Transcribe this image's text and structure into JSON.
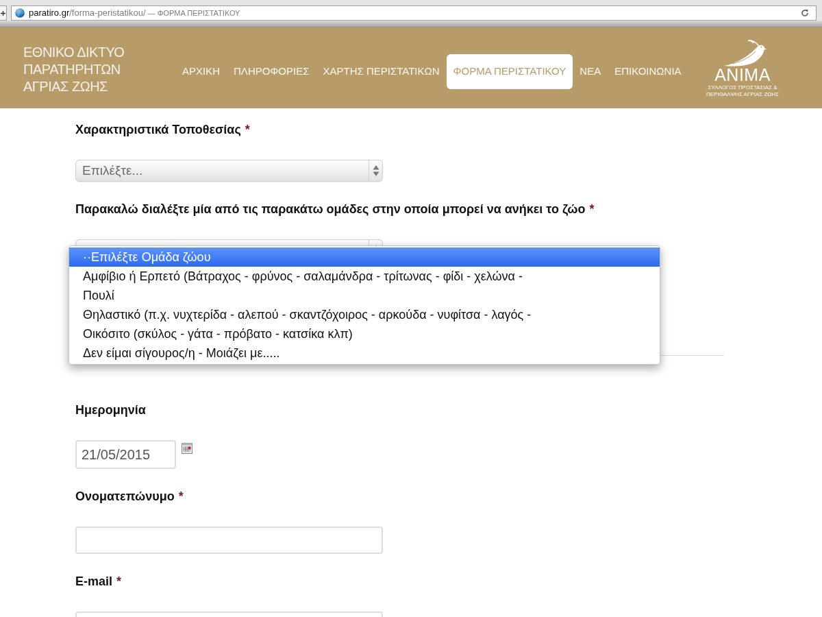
{
  "browser": {
    "address_bar": {
      "host": "paratiro.gr",
      "path": "/forma-peristatikou/",
      "title": "— ΦΟΡΜΑ ΠΕΡΙΣΤΑΤΙΚΟΥ"
    }
  },
  "header": {
    "site_title": [
      "ΕΘΝΙΚΟ ΔΙΚΤΥΟ",
      "ΠΑΡΑΤΗΡΗΤΩΝ",
      "ΑΓΡΙΑΣ ΖΩΗΣ"
    ],
    "nav": [
      {
        "label": "ΑΡΧΙΚΗ",
        "selected": false
      },
      {
        "label": "ΠΛΗΡΟΦΟΡΙΕΣ",
        "selected": false
      },
      {
        "label": "ΧΑΡΤΗΣ ΠΕΡΙΣΤΑΤΙΚΩΝ",
        "selected": false
      },
      {
        "label": "ΦΟΡΜΑ ΠΕΡΙΣΤΑΤΙΚΟΥ",
        "selected": true
      },
      {
        "label": "ΝΕΑ",
        "selected": false
      },
      {
        "label": "ΕΠΙΚΟΙΝΩΝΙΑ",
        "selected": false
      }
    ],
    "logo": {
      "name": "ANIMA",
      "tagline": [
        "ΣΥΛΛΟΓΟΣ ΠΡΟΣΤΑΣΙΑΣ &",
        "ΠΕΡΙΘΑΛΨΗΣ ΑΓΡΙΑΣ ΖΩΗΣ"
      ]
    }
  },
  "form": {
    "sections": [
      {
        "fields": [
          {
            "kind": "select",
            "label": "Χαρακτηριστικά Τοποθεσίας",
            "required_mark": "*",
            "value": "Επιλέξτε..."
          },
          {
            "kind": "select",
            "label": "Παρακαλώ διαλέξτε μία από τις παρακάτω ομάδες στην οποία μπορεί να ανήκει το ζώο",
            "required_mark": "*",
            "expanded": true,
            "options": [
              {
                "label": "··Επιλέξτε Ομάδα ζώου",
                "selected": true
              },
              {
                "label": "Αμφίβιο ή Ερπετό (Βάτραχος - φρύνος - σαλαμάνδρα - τρίτωνας - φίδι - χελώνα -",
                "selected": false
              },
              {
                "label": "Πουλί",
                "selected": false
              },
              {
                "label": "Θηλαστικό (π.χ. νυχτερίδα - αλεπού - σκαντζόχοιρος - αρκούδα - νυφίτσα - λαγός -",
                "selected": false
              },
              {
                "label": "Οικόσιτο (σκύλος - γάτα - πρόβατο - κατσίκα κλπ)",
                "selected": false
              },
              {
                "label": "Δεν είμαι σίγουρος/η - Μοιάζει με.....",
                "selected": false
              }
            ]
          }
        ]
      },
      {
        "fields": [
          {
            "kind": "date",
            "label": "Ημερομηνία",
            "value": "21/05/2015"
          },
          {
            "kind": "text",
            "label": "Ονοματεπώνυμο",
            "required_mark": "*"
          },
          {
            "kind": "text",
            "label": "E-mail",
            "required_mark": "*"
          }
        ]
      }
    ]
  }
}
